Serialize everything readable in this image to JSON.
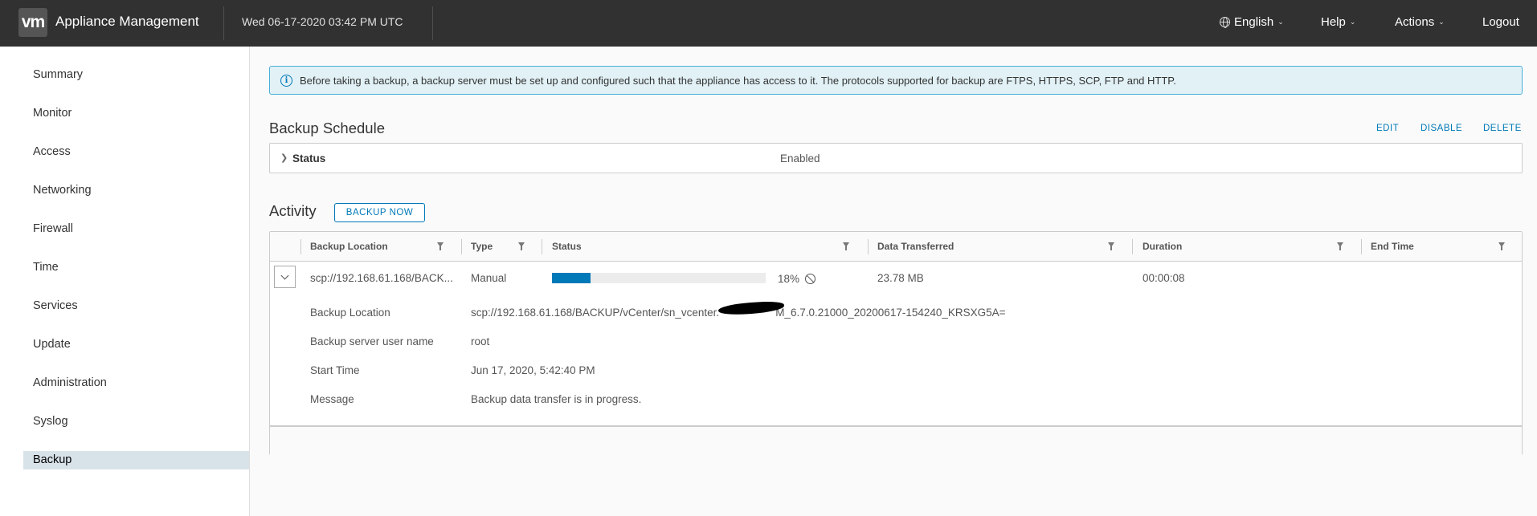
{
  "header": {
    "logo": "vm",
    "app_title": "Appliance Management",
    "datetime": "Wed 06-17-2020 03:42 PM UTC",
    "language": "English",
    "help": "Help",
    "actions": "Actions",
    "logout": "Logout"
  },
  "sidebar": {
    "items": [
      {
        "label": "Summary"
      },
      {
        "label": "Monitor"
      },
      {
        "label": "Access"
      },
      {
        "label": "Networking"
      },
      {
        "label": "Firewall"
      },
      {
        "label": "Time"
      },
      {
        "label": "Services"
      },
      {
        "label": "Update"
      },
      {
        "label": "Administration"
      },
      {
        "label": "Syslog"
      },
      {
        "label": "Backup",
        "active": true
      }
    ]
  },
  "alert": {
    "text": "Before taking a backup, a backup server must be set up and configured such that the appliance has access to it. The protocols supported for backup are FTPS, HTTPS, SCP, FTP and HTTP."
  },
  "schedule": {
    "title": "Backup Schedule",
    "edit": "EDIT",
    "disable": "DISABLE",
    "delete": "DELETE",
    "status_label": "Status",
    "status_value": "Enabled"
  },
  "activity": {
    "title": "Activity",
    "backup_now": "BACKUP NOW",
    "columns": [
      "Backup Location",
      "Type",
      "Status",
      "Data Transferred",
      "Duration",
      "End Time"
    ],
    "row": {
      "location": "scp://192.168.61.168/BACK...",
      "type": "Manual",
      "progress_percent": 18,
      "progress_text": "18%",
      "data_transferred": "23.78 MB",
      "duration": "00:00:08",
      "end_time": ""
    },
    "details": {
      "location_label": "Backup Location",
      "location_value_a": "scp://192.168.61.168/BACKUP/vCenter/sn_vcenter.",
      "location_value_b": "M_6.7.0.21000_20200617-154240_KRSXG5A=",
      "user_label": "Backup server user name",
      "user_value": "root",
      "start_label": "Start Time",
      "start_value": "Jun 17, 2020, 5:42:40 PM",
      "message_label": "Message",
      "message_value": "Backup data transfer is in progress."
    }
  },
  "colors": {
    "header_bg": "#313131",
    "accent": "#0079b8",
    "active_nav": "#d8e3e9",
    "alert_bg": "#e1f1f6"
  }
}
